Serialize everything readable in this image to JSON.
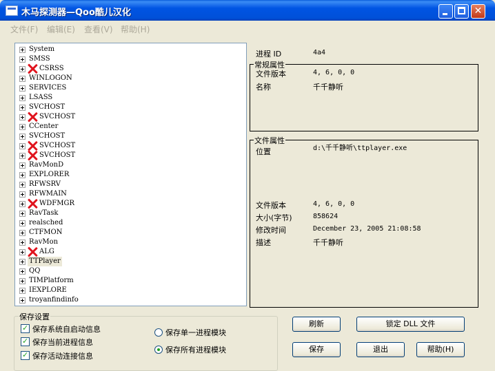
{
  "window": {
    "title": "木马探测器—Qoo酷儿汉化"
  },
  "menu": [
    "文件(F)",
    "编辑(E)",
    "查看(V)",
    "帮助(H)"
  ],
  "processes": [
    {
      "name": "System",
      "flag": false
    },
    {
      "name": "SMSS",
      "flag": false
    },
    {
      "name": "CSRSS",
      "flag": true
    },
    {
      "name": "WINLOGON",
      "flag": false
    },
    {
      "name": "SERVICES",
      "flag": false
    },
    {
      "name": "LSASS",
      "flag": false
    },
    {
      "name": "SVCHOST",
      "flag": false
    },
    {
      "name": "SVCHOST",
      "flag": true
    },
    {
      "name": "CCenter",
      "flag": false
    },
    {
      "name": "SVCHOST",
      "flag": false
    },
    {
      "name": "SVCHOST",
      "flag": true
    },
    {
      "name": "SVCHOST",
      "flag": true
    },
    {
      "name": "RavMonD",
      "flag": false
    },
    {
      "name": "EXPLORER",
      "flag": false
    },
    {
      "name": "RFWSRV",
      "flag": false
    },
    {
      "name": "RFWMAIN",
      "flag": false
    },
    {
      "name": "WDFMGR",
      "flag": true
    },
    {
      "name": "RavTask",
      "flag": false
    },
    {
      "name": "realsched",
      "flag": false
    },
    {
      "name": "CTFMON",
      "flag": false
    },
    {
      "name": "RavMon",
      "flag": false
    },
    {
      "name": "ALG",
      "flag": true
    },
    {
      "name": "TTPlayer",
      "flag": false,
      "selected": true
    },
    {
      "name": "QQ",
      "flag": false
    },
    {
      "name": "TIMPlatform",
      "flag": false
    },
    {
      "name": "IEXPLORE",
      "flag": false
    },
    {
      "name": "troyanfindinfo",
      "flag": false
    }
  ],
  "info": {
    "pid_label": "进程 ID",
    "pid_value": "4a4",
    "general": {
      "title": "常规属性",
      "version_label": "文件版本",
      "version_value": "4, 6, 0, 0",
      "name_label": "名称",
      "name_value": "千千静听"
    },
    "file": {
      "title": "文件属性",
      "location_label": "位置",
      "location_value": "d:\\千千静听\\ttplayer.exe",
      "version_label": "文件版本",
      "version_value": "4, 6, 0, 0",
      "size_label": "大小(字节)",
      "size_value": "858624",
      "modified_label": "修改时间",
      "modified_value": "December 23, 2005 21:08:58",
      "desc_label": "描述",
      "desc_value": "千千静听"
    }
  },
  "save": {
    "title": "保存设置",
    "checkboxes": [
      "保存系统自启动信息",
      "保存当前进程信息",
      "保存活动连接信息"
    ],
    "radios": [
      "保存单一进程模块",
      "保存所有进程模块"
    ],
    "radio_selected": 1
  },
  "buttons": {
    "refresh": "刷新",
    "lock_dll": "锁定 DLL 文件",
    "save": "保存",
    "exit": "退出",
    "help": "帮助(H)"
  }
}
